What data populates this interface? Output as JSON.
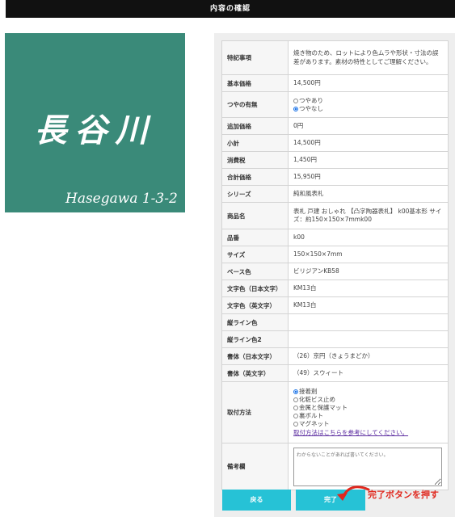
{
  "header": {
    "title": "内容の確認"
  },
  "product_image": {
    "kanji": "長谷川",
    "romaji": "Hasegawa 1-3-2",
    "background": "#3a8a79"
  },
  "rows": [
    {
      "label": "特記事項",
      "value": "焼き物のため、ロットにより色ムラや形状・寸法の誤差があります。素材の特性としてご理解ください。"
    },
    {
      "label": "基本価格",
      "value": "14,500円"
    },
    {
      "label": "つやの有無",
      "options": [
        {
          "label": "つやあり",
          "checked": false
        },
        {
          "label": "つやなし",
          "checked": true
        }
      ]
    },
    {
      "label": "追加価格",
      "value": "0円"
    },
    {
      "label": "小計",
      "value": "14,500円"
    },
    {
      "label": "消費税",
      "value": "1,450円"
    },
    {
      "label": "合計価格",
      "value": "15,950円"
    },
    {
      "label": "シリーズ",
      "value": "純和風表札"
    },
    {
      "label": "商品名",
      "value": "表札 戸建 おしゃれ 【凸字陶器表札】 k00基本形 サイズ：約150×150×7mmk00"
    },
    {
      "label": "品番",
      "value": "k00"
    },
    {
      "label": "サイズ",
      "value": "150×150×7mm"
    },
    {
      "label": "ベース色",
      "value": "ビリジアンKB58"
    },
    {
      "label": "文字色（日本文字）",
      "value": "KM13白"
    },
    {
      "label": "文字色（英文字）",
      "value": "KM13白"
    },
    {
      "label": "縦ライン色",
      "value": ""
    },
    {
      "label": "縦ライン色2",
      "value": ""
    },
    {
      "label": "書体（日本文字）",
      "value": "（26）京円（きょうまどか）"
    },
    {
      "label": "書体（英文字）",
      "value": "（49）スウィート"
    },
    {
      "label": "取付方法",
      "options": [
        {
          "label": "接着剤",
          "checked": true
        },
        {
          "label": "化粧ビス止め",
          "checked": false
        },
        {
          "label": "金属と保護マット",
          "checked": false
        },
        {
          "label": "裏ボルト",
          "checked": false
        },
        {
          "label": "マグネット",
          "checked": false
        }
      ],
      "link": "取付方法はこちらを参考にしてください。"
    },
    {
      "label": "備考欄",
      "placeholder": "わからないことがあれば書いてください。"
    }
  ],
  "buttons": {
    "back": "戻る",
    "done": "完了"
  },
  "annotation": {
    "text": "完了ボタンを押す",
    "color": "#e0281e"
  }
}
